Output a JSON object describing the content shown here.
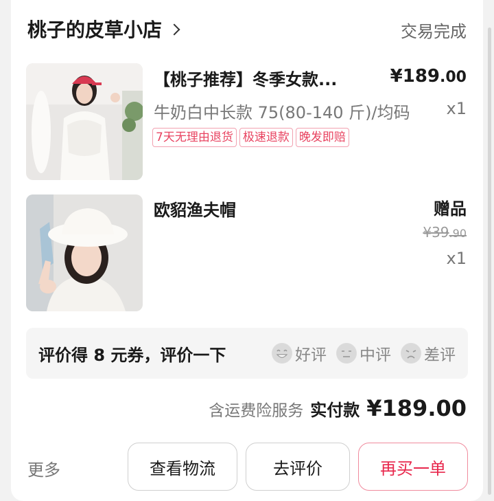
{
  "store": {
    "name": "桃子的皮草小店",
    "status": "交易完成"
  },
  "products": [
    {
      "title": "【桃子推荐】冬季女款...",
      "price_prefix": "¥189",
      "price_dec": ".00",
      "variant": "牛奶白中长款 75(80-140 斤)/均码",
      "qty": "x1",
      "tags": [
        "7天无理由退货",
        "极速退款",
        "晚发即赔"
      ]
    },
    {
      "title": "欧貂渔夫帽",
      "gift_label": "赠品",
      "orig_price_prefix": "¥39",
      "orig_price_dec": ".90",
      "qty": "x1"
    }
  ],
  "review": {
    "prompt": "评价得 8 元券，评价一下",
    "options": [
      {
        "label": "好评",
        "icon": "happy-face-icon"
      },
      {
        "label": "中评",
        "icon": "neutral-face-icon"
      },
      {
        "label": "差评",
        "icon": "sad-face-icon"
      }
    ]
  },
  "summary": {
    "service": "含运费险服务",
    "paid_label": "实付款",
    "paid_amount": "¥189.00"
  },
  "actions": {
    "more": "更多",
    "logistics": "查看物流",
    "review": "去评价",
    "rebuy": "再买一单"
  },
  "colors": {
    "accent": "#e8274c",
    "tag_border": "#f2a1b0",
    "review_bg": "#f5f5f5"
  }
}
